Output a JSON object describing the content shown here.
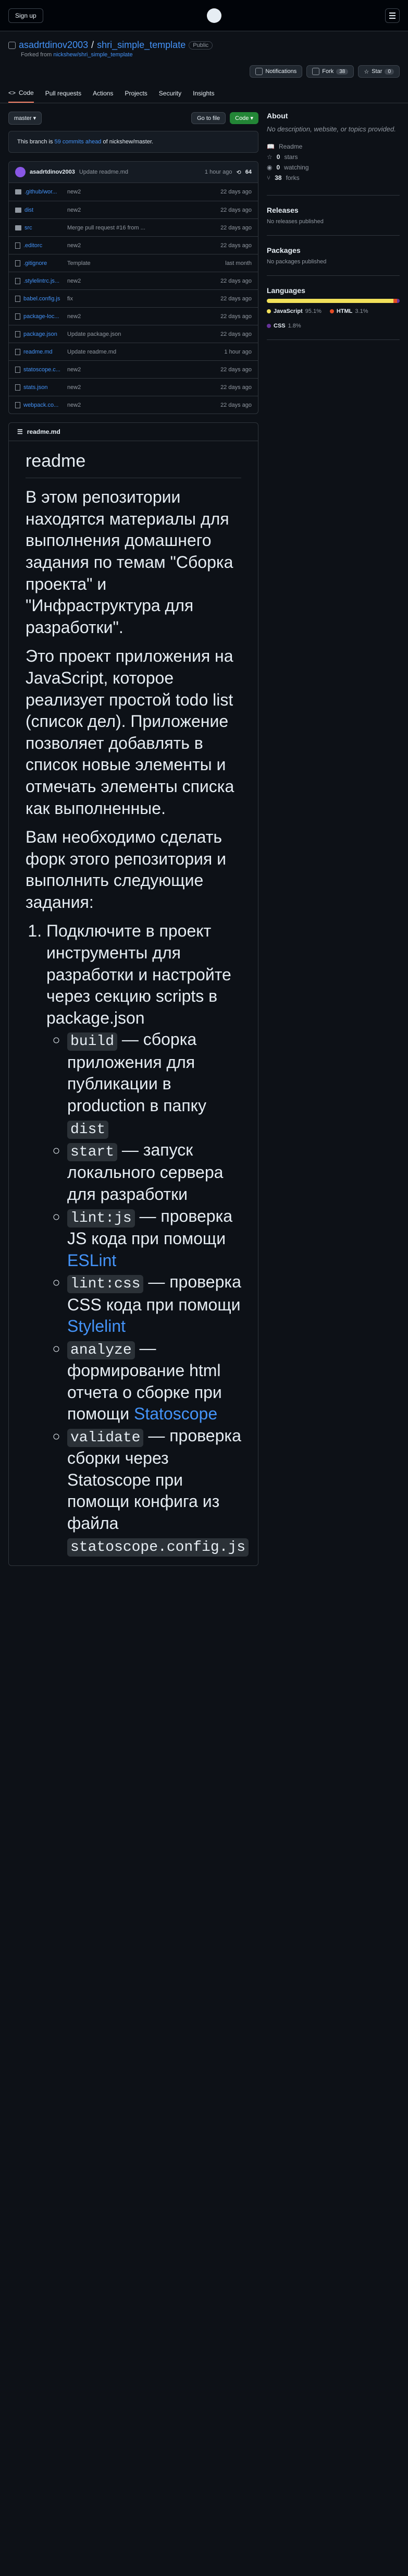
{
  "topbar": {
    "signup": "Sign up"
  },
  "repo": {
    "owner": "asadrtdinov2003",
    "name": "shri_simple_template",
    "visibility": "Public",
    "forked_prefix": "Forked from",
    "forked_from": "nickshew/shri_simple_template"
  },
  "actions": {
    "notifications": "Notifications",
    "fork": "Fork",
    "fork_count": "38",
    "star": "Star",
    "star_count": "0"
  },
  "tabs": [
    {
      "label": "Code"
    },
    {
      "label": "Pull requests"
    },
    {
      "label": "Actions"
    },
    {
      "label": "Projects"
    },
    {
      "label": "Security"
    },
    {
      "label": "Insights"
    }
  ],
  "branch": "master",
  "goto": "Go to file",
  "code": "Code",
  "ahead": {
    "prefix": "This branch is",
    "link": "59 commits ahead",
    "suffix": "of nickshew/master."
  },
  "commit": {
    "author": "asadrtdinov2003",
    "message": "Update readme.md",
    "ago": "1 hour ago",
    "count": "64"
  },
  "files": [
    {
      "name": ".github/wor...",
      "type": "dir",
      "msg": "new2",
      "date": "22 days ago"
    },
    {
      "name": "dist",
      "type": "dir",
      "msg": "new2",
      "date": "22 days ago"
    },
    {
      "name": "src",
      "type": "dir",
      "msg": "Merge pull request #16 from ...",
      "date": "22 days ago"
    },
    {
      "name": ".editorc",
      "type": "file",
      "msg": "new2",
      "date": "22 days ago"
    },
    {
      "name": ".gitignore",
      "type": "file",
      "msg": "Template",
      "date": "last month"
    },
    {
      "name": ".stylelintrc.js...",
      "type": "file",
      "msg": "new2",
      "date": "22 days ago"
    },
    {
      "name": "babel.config.js",
      "type": "file",
      "msg": "fix",
      "date": "22 days ago"
    },
    {
      "name": "package-loc...",
      "type": "file",
      "msg": "new2",
      "date": "22 days ago"
    },
    {
      "name": "package.json",
      "type": "file",
      "msg": "Update package.json",
      "date": "22 days ago"
    },
    {
      "name": "readme.md",
      "type": "file",
      "msg": "Update readme.md",
      "date": "1 hour ago"
    },
    {
      "name": "statoscope.c...",
      "type": "file",
      "msg": "new2",
      "date": "22 days ago"
    },
    {
      "name": "stats.json",
      "type": "file",
      "msg": "new2",
      "date": "22 days ago"
    },
    {
      "name": "webpack.co...",
      "type": "file",
      "msg": "new2",
      "date": "22 days ago"
    }
  ],
  "readme": {
    "file": "readme.md",
    "title": "readme",
    "p1": "В этом репозитории находятся материалы для выполнения домашнего задания по темам \"Сборка проекта\" и \"Инфраструктура для разработки\".",
    "p2": "Это проект приложения на JavaScript, которое реализует простой todo list (список дел). Приложение позволяет добавлять в список новые элементы и отмечать элементы списка как выполненные.",
    "p3": "Вам необходимо сделать форк этого репозитория и выполнить следующие задания:",
    "item1": "Подключите в проект инструменты для разработки и настройте через секцию scripts в package.json",
    "scripts": [
      {
        "code": "build",
        "text": "— сборка приложения для публикации в production в папку",
        "code2": "dist"
      },
      {
        "code": "start",
        "text": "— запуск локального сервера для разработки",
        "code2": ""
      },
      {
        "code": "lint:js",
        "text": "— проверка JS кода при помощи",
        "link": "ESLint"
      },
      {
        "code": "lint:css",
        "text": "— проверка CSS кода при помощи",
        "link": "Stylelint"
      },
      {
        "code": "analyze",
        "text": "— формирование html отчета о сборке при помощи",
        "link": "Statoscope"
      },
      {
        "code": "validate",
        "text": "— проверка сборки через Statoscope при помощи конфига из файла",
        "code2": "statoscope.config.js"
      }
    ]
  },
  "about": {
    "title": "About",
    "desc": "No description, website, or topics provided.",
    "readme": "Readme",
    "stars": "0",
    "stars_label": "stars",
    "watching": "0",
    "watching_label": "watching",
    "forks": "38",
    "forks_label": "forks"
  },
  "releases": {
    "title": "Releases",
    "text": "No releases published"
  },
  "packages": {
    "title": "Packages",
    "text": "No packages published"
  },
  "languages": {
    "title": "Languages",
    "items": [
      {
        "name": "JavaScript",
        "pct": "95.1%",
        "color": "#f1e05a",
        "value": 95.1
      },
      {
        "name": "HTML",
        "pct": "3.1%",
        "color": "#e34c26",
        "value": 3.1
      },
      {
        "name": "CSS",
        "pct": "1.8%",
        "color": "#663399",
        "value": 1.8
      }
    ]
  }
}
